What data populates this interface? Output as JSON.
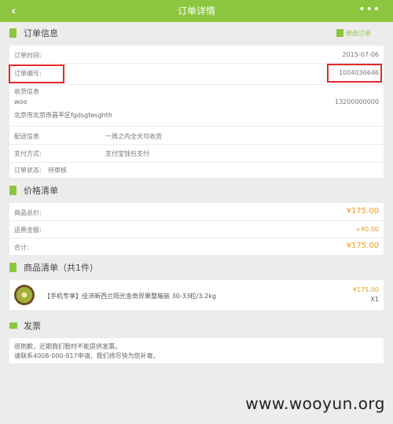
{
  "header": {
    "title": "订单详情",
    "back_symbol": "‹",
    "more_symbol": "•••"
  },
  "order": {
    "section_title": "订单信息",
    "edit_label": "修改订单",
    "time_label": "订单时间:",
    "time_value": "2015-07-06",
    "number_label": "订单编号:",
    "number_value": "1004036646",
    "receiver_label": "收货信息",
    "receiver_name": "woo",
    "receiver_phone": "13200000000",
    "receiver_address": "北京市北京市昌平区fgdsgtesghth",
    "delivery_label": "配送信息",
    "delivery_value": "一周之内全天可收货",
    "payment_label": "支付方式:",
    "payment_value": "支付宝钱包支付",
    "status_label": "订单状态:",
    "status_value": "待审核"
  },
  "price_list": {
    "section_title": "价格清单",
    "total_label": "商品总价:",
    "total_value": "¥175.00",
    "shipping_label": "运费金额:",
    "shipping_value": "+¥0.00",
    "sum_label": "合计:",
    "sum_value": "¥175.00"
  },
  "goods": {
    "section_title": "商品清单（共1件）",
    "item_name": "【手机专享】佳沛新西兰阳光金奇异果整箱装 30-33粒/3.2kg",
    "item_price": "¥175.00",
    "item_qty": "X1"
  },
  "invoice": {
    "section_title": "发票",
    "line1": "很抱歉，近期我们暂时不能提供发票。",
    "line2": "请联系4008-000-917申请，我们将尽快为您补寄。"
  },
  "watermark": "www.wooyun.org",
  "colors": {
    "accent": "#8cc63f",
    "price": "#f39a17",
    "highlight_box": "#e32a2a"
  }
}
